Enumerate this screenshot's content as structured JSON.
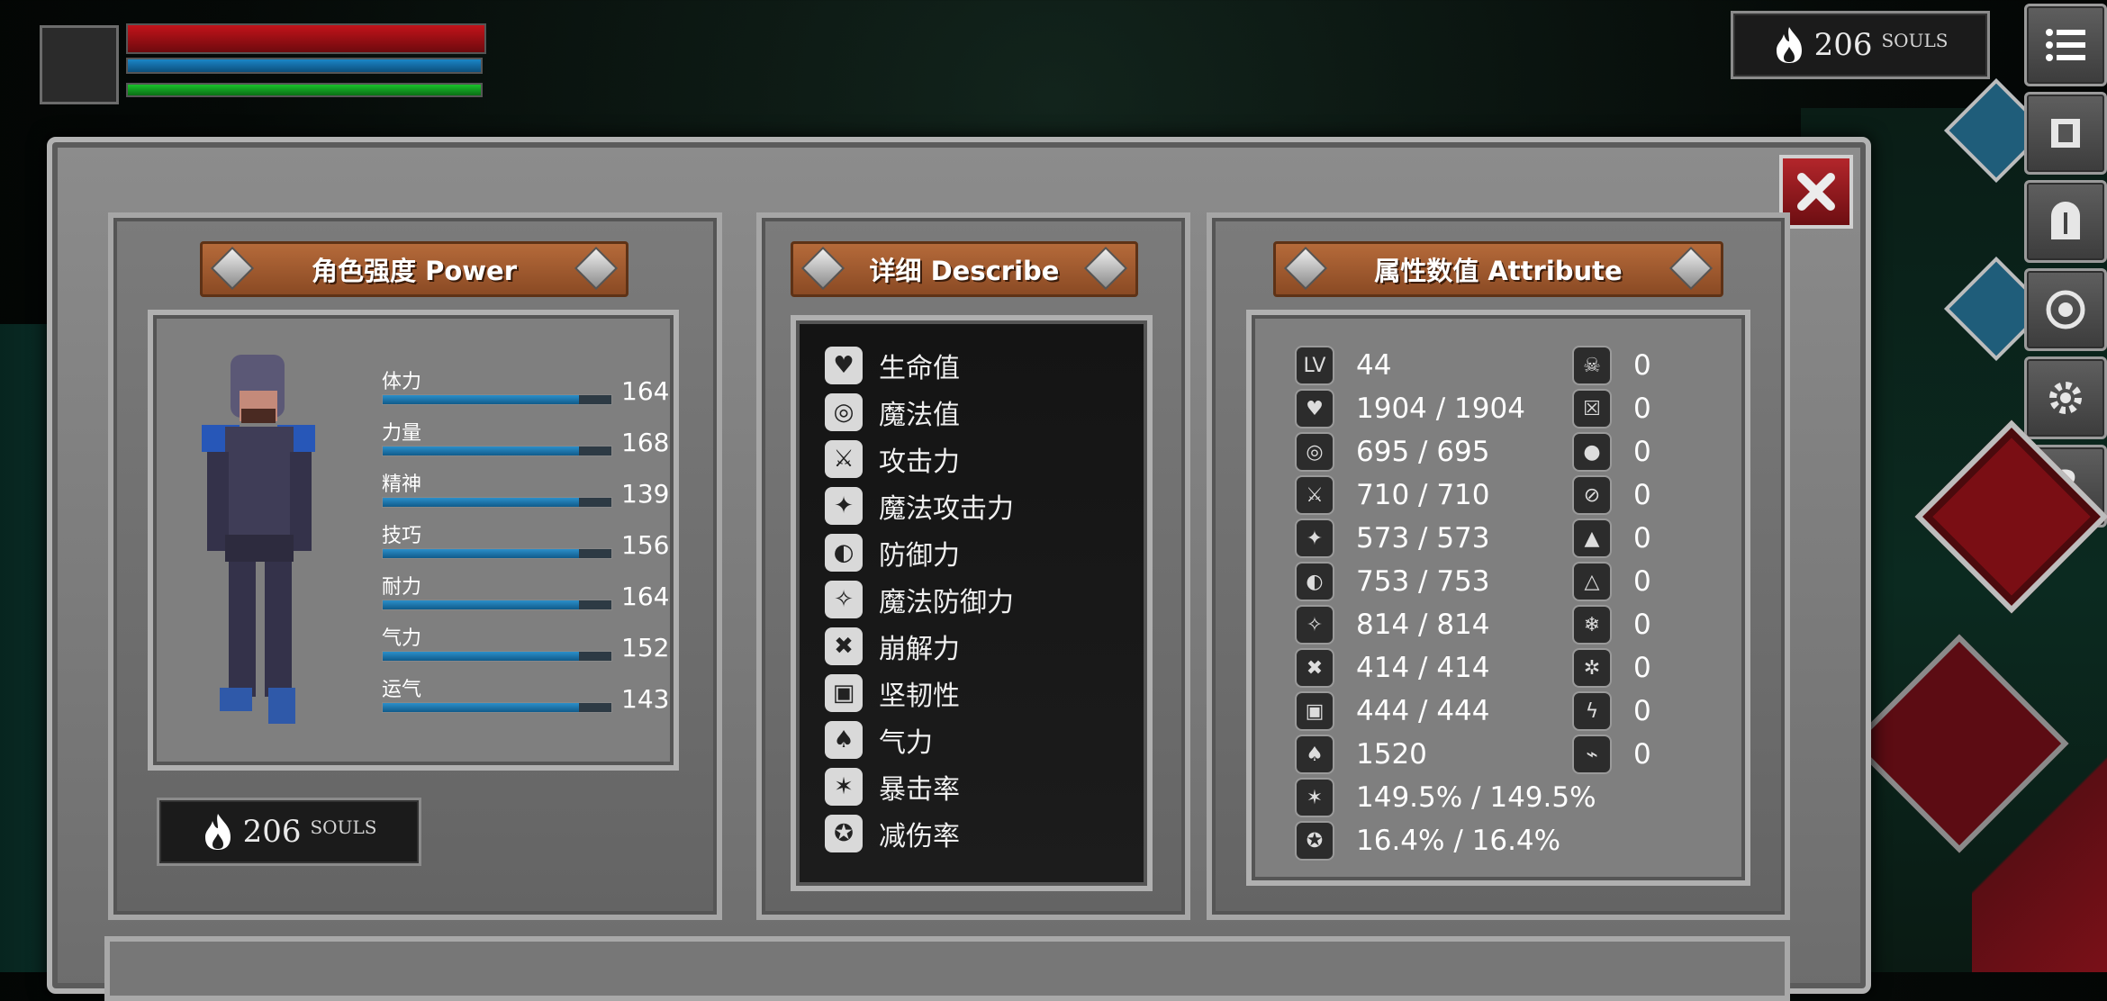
{
  "hud": {
    "health_bar_label": "health",
    "mana_bar_label": "mana",
    "stamina_bar_label": "stamina",
    "souls_count": "206",
    "souls_label": "SOULS"
  },
  "toolbar": {
    "icons": [
      "menu-icon",
      "map-icon",
      "helmet-icon",
      "skill-icon",
      "gear-icon",
      "help-icon"
    ],
    "help_glyph": "?"
  },
  "colors": {
    "hp": "#c2131a",
    "mp": "#1b86c7",
    "sp": "#19c22a",
    "banner": "#a65e30",
    "close": "#a2161c"
  },
  "power_panel": {
    "title": "角色强度 Power",
    "stats": [
      {
        "name": "体力",
        "value": 164,
        "fraction": 0.86
      },
      {
        "name": "力量",
        "value": 168,
        "fraction": 0.86
      },
      {
        "name": "精神",
        "value": 139,
        "fraction": 0.86
      },
      {
        "name": "技巧",
        "value": 156,
        "fraction": 0.86
      },
      {
        "name": "耐力",
        "value": 164,
        "fraction": 0.86
      },
      {
        "name": "气力",
        "value": 152,
        "fraction": 0.86
      },
      {
        "name": "运气",
        "value": 143,
        "fraction": 0.86
      }
    ],
    "souls_count": "206",
    "souls_label": "SOULS"
  },
  "describe_panel": {
    "title": "详细 Describe",
    "rows": [
      "生命值",
      "魔法值",
      "攻击力",
      "魔法攻击力",
      "防御力",
      "魔法防御力",
      "崩解力",
      "坚韧性",
      "气力",
      "暴击率",
      "减伤率"
    ]
  },
  "attribute_panel": {
    "title": "属性数值 Attribute",
    "level_badge": "LV",
    "values": [
      "44",
      "1904 / 1904",
      "695 / 695",
      "710 / 710",
      "573 / 573",
      "753 / 753",
      "814 / 814",
      "414 / 414",
      "444 / 444",
      "1520",
      "149.5% / 149.5%",
      "16.4% / 16.4%"
    ],
    "resistances": [
      "0",
      "0",
      "0",
      "0",
      "0",
      "0",
      "0",
      "0",
      "0",
      "0"
    ]
  }
}
